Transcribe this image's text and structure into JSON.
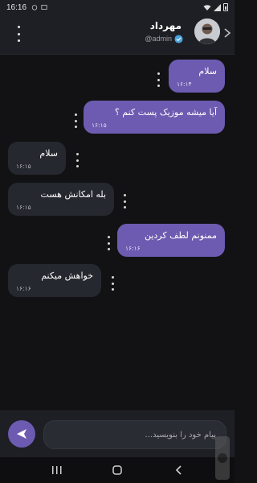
{
  "status_bar": {
    "time": "16:16",
    "icons": [
      "alarm-icon",
      "photo-icon",
      "wifi-icon",
      "signal-icon",
      "battery-icon"
    ]
  },
  "header": {
    "contact_name": "مهرداد",
    "contact_handle": "@admin",
    "icons": [
      "more-vertical-icon",
      "verified-icon",
      "avatar",
      "chevron-right-icon"
    ]
  },
  "messages": [
    {
      "direction": "sent",
      "text": "سلام",
      "time": "۱۶:۱۴"
    },
    {
      "direction": "sent",
      "text": "آیا میشه موزیک پست کنم ؟",
      "time": "۱۶:۱۵"
    },
    {
      "direction": "received",
      "text": "سلام",
      "time": "۱۶:۱۵"
    },
    {
      "direction": "received",
      "text": "بله امکانش هست",
      "time": "۱۶:۱۵"
    },
    {
      "direction": "sent",
      "text": "ممنونم لطف کردین",
      "time": "۱۶:۱۶"
    },
    {
      "direction": "received",
      "text": "خواهش میکنم",
      "time": "۱۶:۱۶"
    }
  ],
  "composer": {
    "placeholder": "پیام خود را بنویسید...",
    "value": "",
    "send_icon": "send-icon"
  },
  "nav_bar": {
    "icons": [
      "recent-apps-icon",
      "home-icon",
      "back-icon"
    ]
  },
  "colors": {
    "background": "#121214",
    "bar": "#1e1f24",
    "sent_bubble": "#6c5bb0",
    "received_bubble": "#26282f",
    "accent": "#6c5bb0"
  }
}
